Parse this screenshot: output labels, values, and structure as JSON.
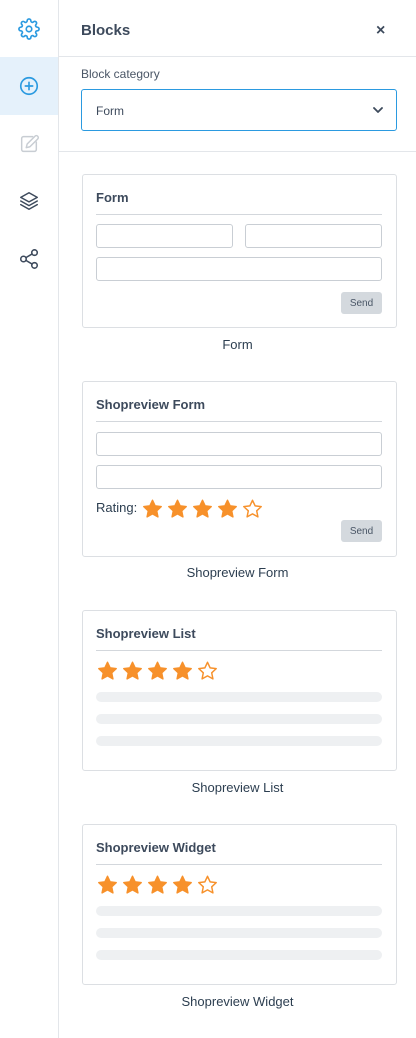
{
  "rail": {
    "items": [
      {
        "icon": "gear-icon"
      },
      {
        "icon": "plus-circle-icon"
      },
      {
        "icon": "edit-icon"
      },
      {
        "icon": "layers-icon"
      },
      {
        "icon": "share-icon"
      }
    ]
  },
  "panel": {
    "title": "Blocks",
    "close": "×",
    "category_label": "Block category",
    "category_value": "Form"
  },
  "blocks": [
    {
      "title": "Form",
      "send": "Send",
      "caption": "Form"
    },
    {
      "title": "Shopreview Form",
      "rating_label": "Rating:",
      "rating": 4,
      "send": "Send",
      "caption": "Shopreview Form"
    },
    {
      "title": "Shopreview List",
      "rating": 4,
      "caption": "Shopreview List"
    },
    {
      "title": "Shopreview Widget",
      "rating": 4,
      "caption": "Shopreview Widget"
    }
  ],
  "colors": {
    "accent": "#2b9ae0",
    "star": "#f7912b",
    "active_bg": "#e5f1fb"
  }
}
